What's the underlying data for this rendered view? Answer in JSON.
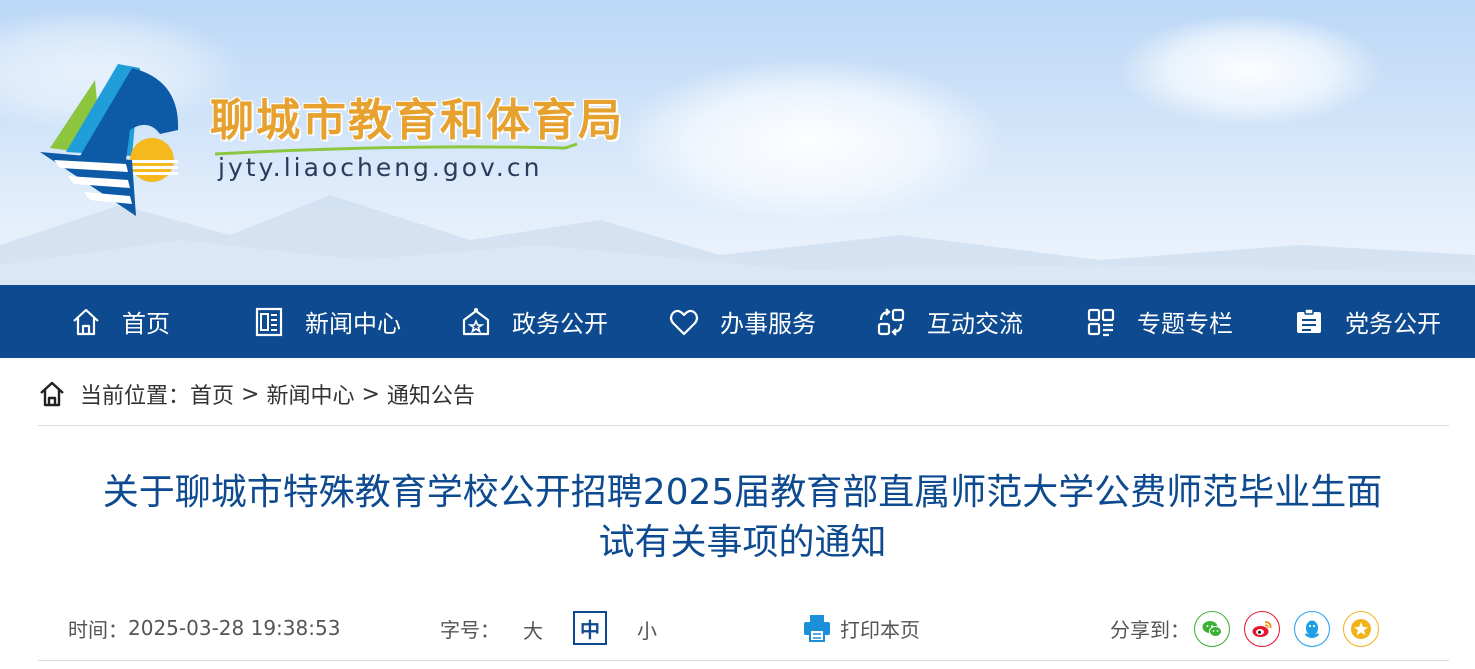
{
  "header": {
    "site_title": "聊城市教育和体育局",
    "site_url": "jyty.liaocheng.gov.cn"
  },
  "nav": {
    "items": [
      {
        "label": "首页",
        "icon": "home-icon"
      },
      {
        "label": "新闻中心",
        "icon": "newspaper-icon"
      },
      {
        "label": "政务公开",
        "icon": "government-icon"
      },
      {
        "label": "办事服务",
        "icon": "heart-icon"
      },
      {
        "label": "互动交流",
        "icon": "interaction-icon"
      },
      {
        "label": "专题专栏",
        "icon": "grid-icon"
      },
      {
        "label": "党务公开",
        "icon": "party-affairs-icon"
      }
    ]
  },
  "breadcrumb": {
    "prefix": "当前位置：",
    "items": [
      "首页",
      "新闻中心",
      "通知公告"
    ],
    "separator": ">"
  },
  "article": {
    "title_line1": "关于聊城市特殊教育学校公开招聘2025届教育部直属师范大学公费师范毕业生面",
    "title_line2": "试有关事项的通知",
    "time_label": "时间：",
    "time_value": "2025-03-28 19:38:53",
    "font_size_label": "字号：",
    "font_sizes": [
      "大",
      "中",
      "小"
    ],
    "font_size_selected": "中",
    "print_label": "打印本页",
    "share_label": "分享到："
  },
  "share": {
    "targets": [
      {
        "name": "wechat-icon",
        "color": "#3cb035"
      },
      {
        "name": "weibo-icon",
        "color": "#e6162d"
      },
      {
        "name": "qq-icon",
        "color": "#1e9fe6"
      },
      {
        "name": "qzone-icon",
        "color": "#f2b318"
      }
    ]
  },
  "colors": {
    "nav_bg": "#0d4a8f",
    "title": "#0d4a8f",
    "site_title": "#e6a12e"
  }
}
